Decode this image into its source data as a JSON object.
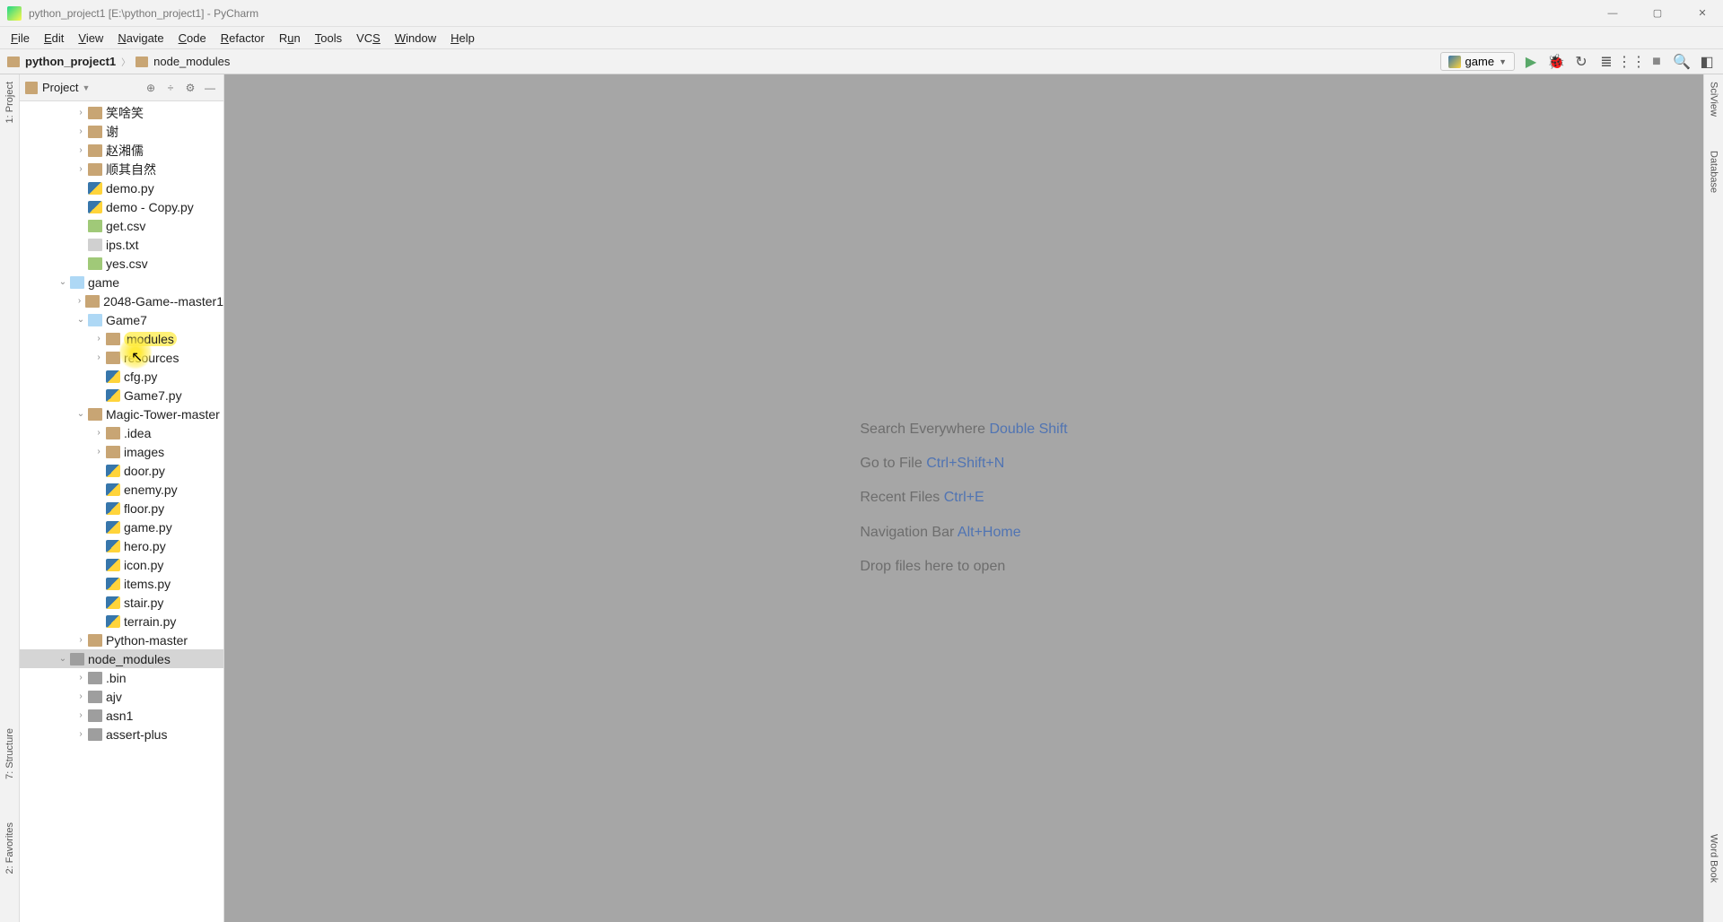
{
  "window": {
    "title": "python_project1 [E:\\python_project1] - PyCharm"
  },
  "menu": {
    "file": "File",
    "edit": "Edit",
    "view": "View",
    "navigate": "Navigate",
    "code": "Code",
    "refactor": "Refactor",
    "run": "Run",
    "tools": "Tools",
    "vcs": "VCS",
    "window": "Window",
    "help": "Help"
  },
  "breadcrumb": {
    "root": "python_project1",
    "item1": "node_modules"
  },
  "run_config": {
    "name": "game"
  },
  "sidebar": {
    "header": "Project"
  },
  "left_gutter": {
    "project": "1: Project",
    "structure": "7: Structure",
    "favorites": "2: Favorites"
  },
  "right_gutter": {
    "sciview": "SciView",
    "database": "Database",
    "wordbook": "Word Book"
  },
  "tree": [
    {
      "id": 0,
      "indent": 3,
      "icon": "folder",
      "arrow": "right",
      "label": "笑啥笑"
    },
    {
      "id": 1,
      "indent": 3,
      "icon": "folder",
      "arrow": "right",
      "label": "谢"
    },
    {
      "id": 2,
      "indent": 3,
      "icon": "folder",
      "arrow": "right",
      "label": "赵湘儒"
    },
    {
      "id": 3,
      "indent": 3,
      "icon": "folder",
      "arrow": "right",
      "label": "顺其自然"
    },
    {
      "id": 4,
      "indent": 3,
      "icon": "pyfile",
      "arrow": "none",
      "label": "demo.py"
    },
    {
      "id": 5,
      "indent": 3,
      "icon": "pyfile",
      "arrow": "none",
      "label": "demo - Copy.py"
    },
    {
      "id": 6,
      "indent": 3,
      "icon": "csvfile",
      "arrow": "none",
      "label": "get.csv"
    },
    {
      "id": 7,
      "indent": 3,
      "icon": "txtfile",
      "arrow": "none",
      "label": "ips.txt"
    },
    {
      "id": 8,
      "indent": 3,
      "icon": "csvfile",
      "arrow": "none",
      "label": "yes.csv"
    },
    {
      "id": 9,
      "indent": 2,
      "icon": "folder-open",
      "arrow": "down",
      "label": "game"
    },
    {
      "id": 10,
      "indent": 3,
      "icon": "folder",
      "arrow": "right",
      "label": "2048-Game--master1"
    },
    {
      "id": 11,
      "indent": 3,
      "icon": "folder-open",
      "arrow": "down",
      "label": "Game7"
    },
    {
      "id": 12,
      "indent": 4,
      "icon": "folder",
      "arrow": "right",
      "label": "modules",
      "hl": true
    },
    {
      "id": 13,
      "indent": 4,
      "icon": "folder",
      "arrow": "right",
      "label": "resources"
    },
    {
      "id": 14,
      "indent": 4,
      "icon": "pyfile",
      "arrow": "none",
      "label": "cfg.py"
    },
    {
      "id": 15,
      "indent": 4,
      "icon": "pyfile",
      "arrow": "none",
      "label": "Game7.py"
    },
    {
      "id": 16,
      "indent": 3,
      "icon": "folder",
      "arrow": "down",
      "label": "Magic-Tower-master"
    },
    {
      "id": 17,
      "indent": 4,
      "icon": "folder",
      "arrow": "right",
      "label": ".idea"
    },
    {
      "id": 18,
      "indent": 4,
      "icon": "folder",
      "arrow": "right",
      "label": "images"
    },
    {
      "id": 19,
      "indent": 4,
      "icon": "pyfile",
      "arrow": "none",
      "label": "door.py"
    },
    {
      "id": 20,
      "indent": 4,
      "icon": "pyfile",
      "arrow": "none",
      "label": "enemy.py"
    },
    {
      "id": 21,
      "indent": 4,
      "icon": "pyfile",
      "arrow": "none",
      "label": "floor.py"
    },
    {
      "id": 22,
      "indent": 4,
      "icon": "pyfile",
      "arrow": "none",
      "label": "game.py"
    },
    {
      "id": 23,
      "indent": 4,
      "icon": "pyfile",
      "arrow": "none",
      "label": "hero.py"
    },
    {
      "id": 24,
      "indent": 4,
      "icon": "pyfile",
      "arrow": "none",
      "label": "icon.py"
    },
    {
      "id": 25,
      "indent": 4,
      "icon": "pyfile",
      "arrow": "none",
      "label": "items.py"
    },
    {
      "id": 26,
      "indent": 4,
      "icon": "pyfile",
      "arrow": "none",
      "label": "stair.py"
    },
    {
      "id": 27,
      "indent": 4,
      "icon": "pyfile",
      "arrow": "none",
      "label": "terrain.py"
    },
    {
      "id": 28,
      "indent": 3,
      "icon": "folder",
      "arrow": "right",
      "label": "Python-master"
    },
    {
      "id": 29,
      "indent": 2,
      "icon": "folder-dark",
      "arrow": "down",
      "label": "node_modules",
      "selected": true
    },
    {
      "id": 30,
      "indent": 3,
      "icon": "folder-dark",
      "arrow": "right",
      "label": ".bin"
    },
    {
      "id": 31,
      "indent": 3,
      "icon": "folder-dark",
      "arrow": "right",
      "label": "ajv"
    },
    {
      "id": 32,
      "indent": 3,
      "icon": "folder-dark",
      "arrow": "right",
      "label": "asn1"
    },
    {
      "id": 33,
      "indent": 3,
      "icon": "folder-dark",
      "arrow": "right",
      "label": "assert-plus"
    }
  ],
  "empty": {
    "l1a": "Search Everywhere ",
    "l1b": "Double Shift",
    "l2a": "Go to File ",
    "l2b": "Ctrl+Shift+N",
    "l3a": "Recent Files ",
    "l3b": "Ctrl+E",
    "l4a": "Navigation Bar ",
    "l4b": "Alt+Home",
    "l5": "Drop files here to open"
  }
}
